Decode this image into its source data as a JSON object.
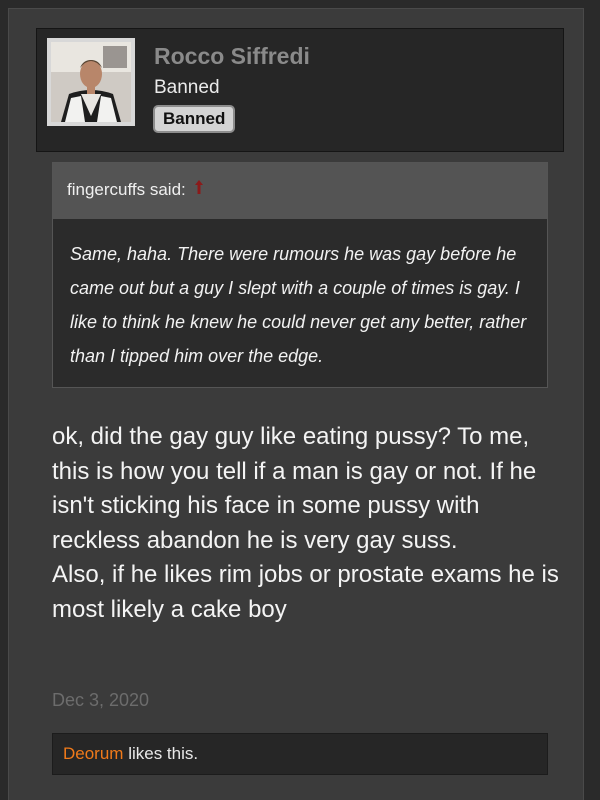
{
  "user": {
    "name": "Rocco Siffredi",
    "title": "Banned",
    "banner": "Banned"
  },
  "quote": {
    "author": "fingercuffs said:",
    "text": "Same, haha. There were rumours he was gay before he came out but a guy I slept with a couple of times is gay. I like to think he knew he could never get any better, rather than I tipped him over the edge."
  },
  "message": {
    "line1": "ok, did the gay guy like eating pussy? To me, this is how you tell if a man is gay or not. If he isn't sticking his face in some pussy with reckless abandon he is very gay suss.",
    "line2": "Also, if he likes rim jobs or prostate exams he is most likely a cake boy"
  },
  "post": {
    "date": "Dec 3, 2020"
  },
  "likes": {
    "liker": "Deorum",
    "suffix": "likes this."
  },
  "colors": {
    "liker": "#f07a1a",
    "quote_arrow": "#8b1a1a",
    "username": "#8a8a8a"
  },
  "icons": {
    "quote_jump": "up-arrow-icon",
    "avatar": "user-photo"
  }
}
